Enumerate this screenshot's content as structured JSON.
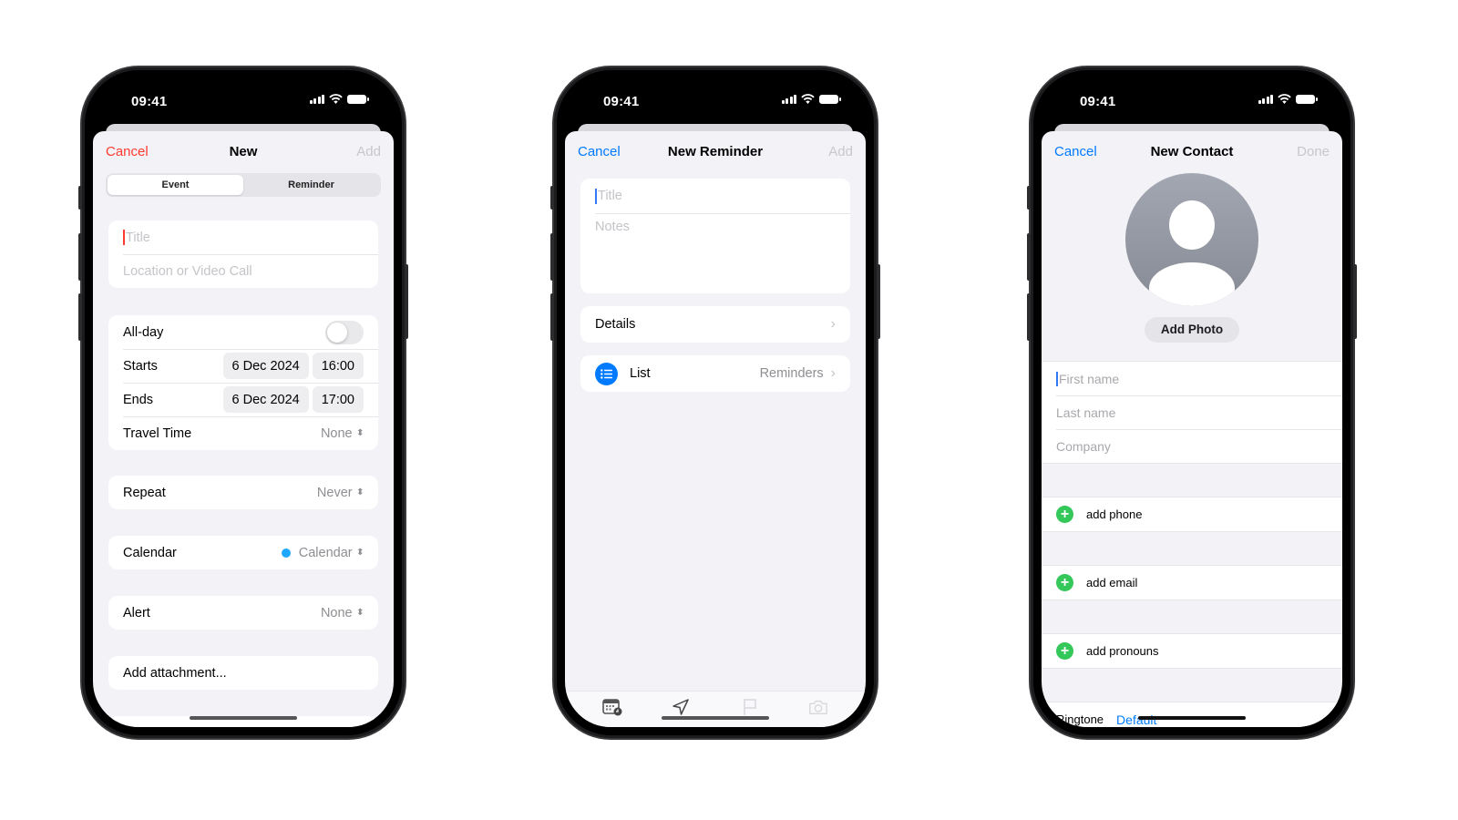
{
  "status_bar": {
    "time": "09:41"
  },
  "event_screen": {
    "nav": {
      "cancel": "Cancel",
      "title": "New",
      "add": "Add"
    },
    "segments": [
      {
        "label": "Event",
        "active": true
      },
      {
        "label": "Reminder",
        "active": false
      }
    ],
    "title_placeholder": "Title",
    "location_placeholder": "Location or Video Call",
    "all_day_label": "All-day",
    "all_day_on": false,
    "starts": {
      "label": "Starts",
      "date": "6 Dec 2024",
      "time": "16:00"
    },
    "ends": {
      "label": "Ends",
      "date": "6 Dec 2024",
      "time": "17:00"
    },
    "travel_time": {
      "label": "Travel Time",
      "value": "None"
    },
    "repeat": {
      "label": "Repeat",
      "value": "Never"
    },
    "calendar": {
      "label": "Calendar",
      "value": "Calendar",
      "color": "#1ea7fd"
    },
    "alert": {
      "label": "Alert",
      "value": "None"
    },
    "attachment_label": "Add attachment...",
    "accent": "#ff3b30"
  },
  "reminder_screen": {
    "nav": {
      "cancel": "Cancel",
      "title": "New Reminder",
      "add": "Add"
    },
    "title_placeholder": "Title",
    "notes_placeholder": "Notes",
    "details_label": "Details",
    "list": {
      "label": "List",
      "value": "Reminders"
    },
    "toolbar": [
      "calendar-clock-icon",
      "location-arrow-icon",
      "flag-icon",
      "camera-icon"
    ],
    "accent": "#007aff"
  },
  "contact_screen": {
    "nav": {
      "cancel": "Cancel",
      "title": "New Contact",
      "done": "Done"
    },
    "add_photo": "Add Photo",
    "first_name_placeholder": "First name",
    "last_name_placeholder": "Last name",
    "company_placeholder": "Company",
    "add_phone": "add phone",
    "add_email": "add email",
    "add_pronouns": "add pronouns",
    "ringtone": {
      "label": "Ringtone",
      "value": "Default"
    },
    "accent": "#007aff"
  }
}
